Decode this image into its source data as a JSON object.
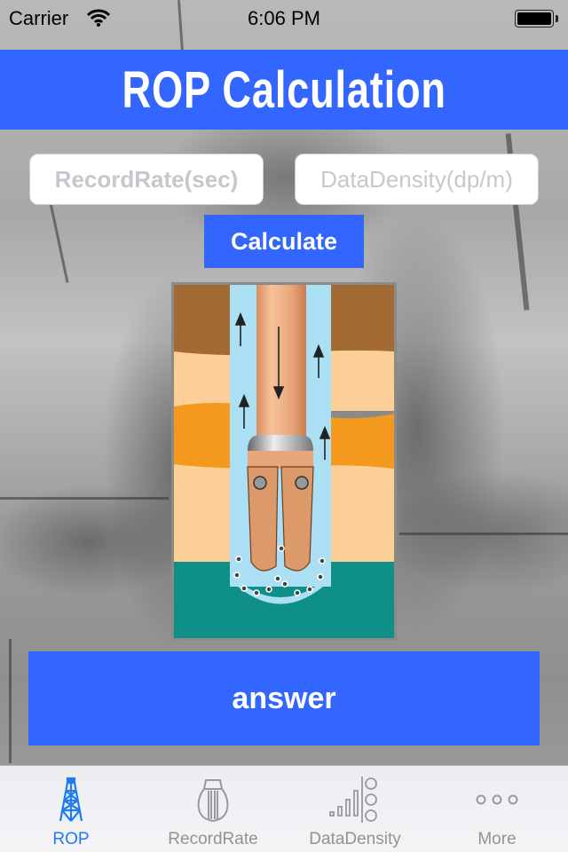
{
  "status_bar": {
    "carrier": "Carrier",
    "time": "6:06 PM",
    "battery_level": 1.0
  },
  "header": {
    "title": "ROP Calculation"
  },
  "form": {
    "record_rate": {
      "value": "",
      "placeholder": "RecordRate(sec)"
    },
    "data_density": {
      "value": "",
      "placeholder": "DataDensity(dp/m)"
    },
    "calculate_label": "Calculate"
  },
  "illustration": {
    "subject": "drill-bit-in-borehole",
    "alt": "Tricone drill bit drilling through rock layers"
  },
  "result": {
    "answer_label": "answer"
  },
  "tab_bar": {
    "items": [
      {
        "label": "ROP",
        "icon": "derrick-icon",
        "active": true
      },
      {
        "label": "RecordRate",
        "icon": "recordrate-icon",
        "active": false
      },
      {
        "label": "DataDensity",
        "icon": "datadensity-icon",
        "active": false
      },
      {
        "label": "More",
        "icon": "more-icon",
        "active": false
      }
    ]
  },
  "colors": {
    "accent": "#3366ff",
    "tab_active": "#1e7cf2",
    "tab_inactive": "#929292",
    "placeholder": "#c7c7cd"
  }
}
